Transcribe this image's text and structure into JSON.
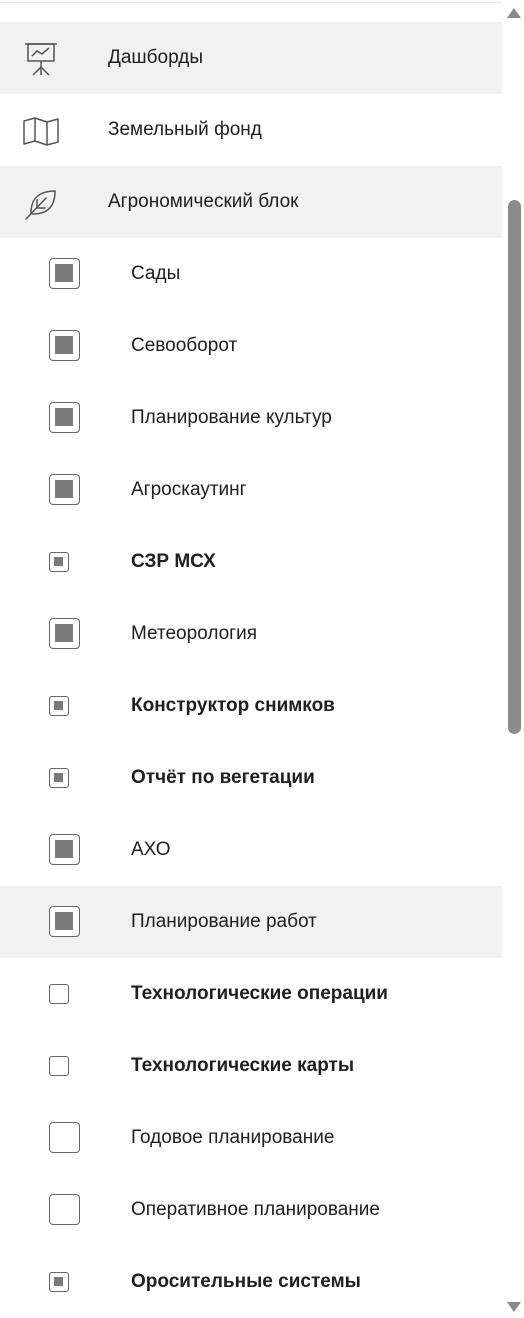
{
  "menu": {
    "top_items": [
      {
        "label": "Дашборды",
        "icon": "presentation-chart-icon"
      },
      {
        "label": "Земельный фонд",
        "icon": "map-icon"
      },
      {
        "label": "Агрономический блок",
        "icon": "leaf-icon"
      }
    ],
    "sub_items": [
      {
        "label": "Сады",
        "state": "partial"
      },
      {
        "label": "Севооборот",
        "state": "partial"
      },
      {
        "label": "Планирование культур",
        "state": "partial"
      },
      {
        "label": "Агроскаутинг",
        "state": "partial"
      },
      {
        "label": "СЗР МСХ",
        "state": "partial"
      },
      {
        "label": "Метеорология",
        "state": "partial"
      },
      {
        "label": "Конструктор снимков",
        "state": "partial"
      },
      {
        "label": "Отчёт по вегетации",
        "state": "partial"
      },
      {
        "label": "АХО",
        "state": "partial"
      },
      {
        "label": "Планирование работ",
        "state": "partial"
      },
      {
        "label": "Технологические операции",
        "state": "unchecked"
      },
      {
        "label": "Технологические карты",
        "state": "unchecked"
      },
      {
        "label": "Годовое планирование",
        "state": "unchecked"
      },
      {
        "label": "Оперативное планирование",
        "state": "unchecked"
      },
      {
        "label": "Оросительные системы",
        "state": "partial"
      }
    ]
  },
  "colors": {
    "highlight": "#f1f1f1",
    "checkbox_fill": "#7a7a7a",
    "scrollbar_thumb": "#8b8b8b"
  }
}
